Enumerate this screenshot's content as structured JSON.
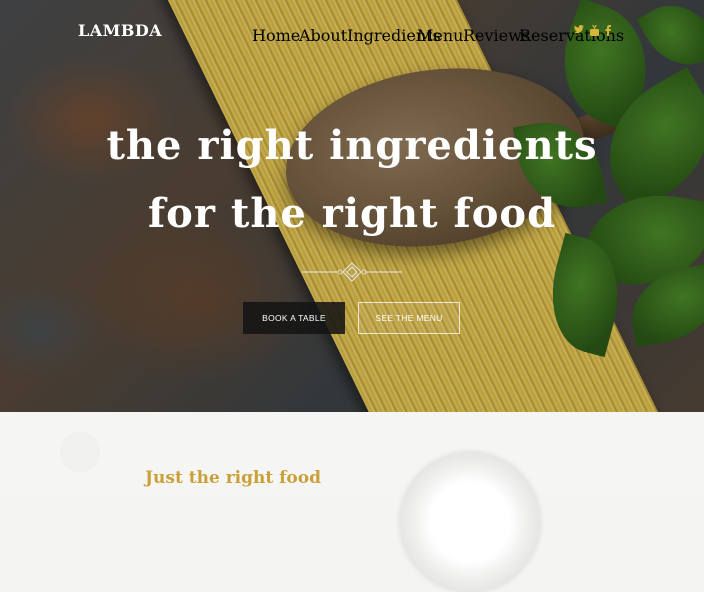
{
  "brand": {
    "logo": "LAMBDA"
  },
  "nav": {
    "items": [
      {
        "label": "Home"
      },
      {
        "label": "About"
      },
      {
        "label": "Ingredients"
      },
      {
        "label": "Menu"
      },
      {
        "label": "Reviews"
      },
      {
        "label": "Reservations"
      }
    ],
    "social_icons": [
      "twitter-icon",
      "youtube-icon",
      "facebook-icon"
    ]
  },
  "hero": {
    "headline_line1": "the right ingredients",
    "headline_line2": "for the right food",
    "book_button": "BOOK A TABLE",
    "menu_button": "SEE THE MENU"
  },
  "section": {
    "title": "Just the right food"
  },
  "colors": {
    "accent": "#caa03a",
    "button_dark": "#141414",
    "social": "#d7b43a"
  }
}
